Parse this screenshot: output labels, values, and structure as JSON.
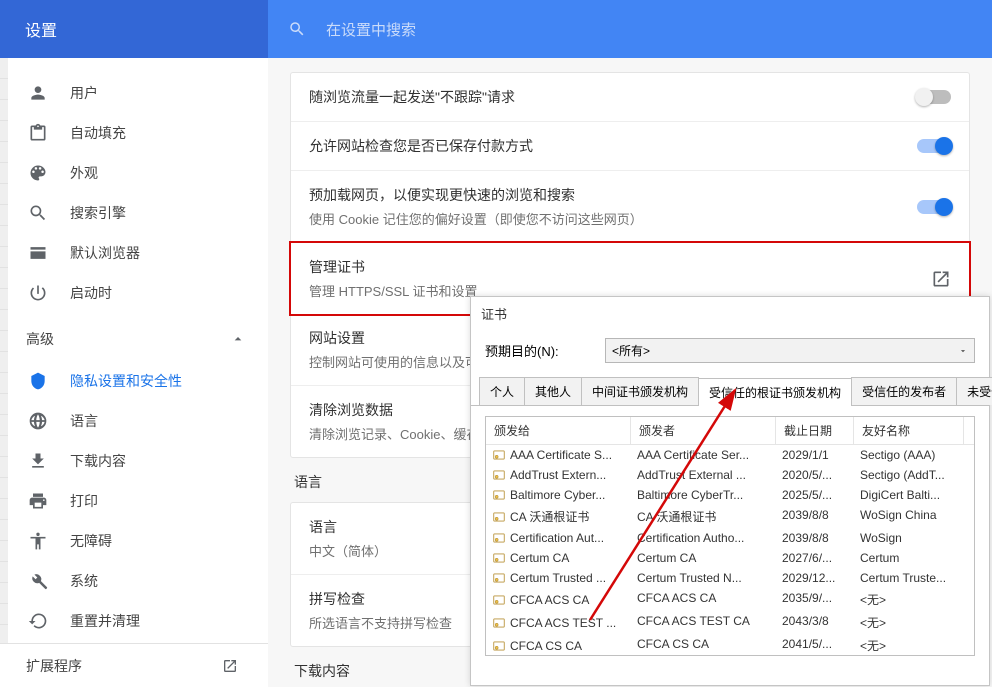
{
  "topbar": {
    "title": "设置",
    "search_placeholder": "在设置中搜索"
  },
  "sidebar": {
    "items": [
      {
        "label": "用户",
        "icon": "person"
      },
      {
        "label": "自动填充",
        "icon": "clipboard"
      },
      {
        "label": "外观",
        "icon": "palette"
      },
      {
        "label": "搜索引擎",
        "icon": "search"
      },
      {
        "label": "默认浏览器",
        "icon": "browser"
      },
      {
        "label": "启动时",
        "icon": "power"
      }
    ],
    "advanced_label": "高级",
    "advanced_items": [
      {
        "label": "隐私设置和安全性",
        "icon": "shield",
        "active": true
      },
      {
        "label": "语言",
        "icon": "globe"
      },
      {
        "label": "下载内容",
        "icon": "download"
      },
      {
        "label": "打印",
        "icon": "print"
      },
      {
        "label": "无障碍",
        "icon": "accessibility"
      },
      {
        "label": "系统",
        "icon": "wrench"
      },
      {
        "label": "重置并清理",
        "icon": "restore"
      }
    ],
    "footer_label": "扩展程序"
  },
  "settings_rows": [
    {
      "title": "随浏览流量一起发送\"不跟踪\"请求",
      "subtitle": "",
      "control": "toggle",
      "value": false
    },
    {
      "title": "允许网站检查您是否已保存付款方式",
      "subtitle": "",
      "control": "toggle",
      "value": true
    },
    {
      "title": "预加载网页，以便实现更快速的浏览和搜索",
      "subtitle": "使用 Cookie 记住您的偏好设置（即使您不访问这些网页）",
      "control": "toggle",
      "value": true
    },
    {
      "title": "管理证书",
      "subtitle": "管理 HTTPS/SSL 证书和设置",
      "control": "launch",
      "highlight": true
    },
    {
      "title": "网站设置",
      "subtitle": "控制网站可使用的信息以及可",
      "control": "none"
    },
    {
      "title": "清除浏览数据",
      "subtitle": "清除浏览记录、Cookie、缓存",
      "control": "none"
    }
  ],
  "lang_section": {
    "label": "语言",
    "rows": [
      {
        "title": "语言",
        "subtitle": "中文（简体）"
      },
      {
        "title": "拼写检查",
        "subtitle": "所选语言不支持拼写检查"
      }
    ]
  },
  "download_section_label": "下载内容",
  "cert_dialog": {
    "title": "证书",
    "purpose_label": "预期目的(N):",
    "purpose_value": "<所有>",
    "tabs": [
      "个人",
      "其他人",
      "中间证书颁发机构",
      "受信任的根证书颁发机构",
      "受信任的发布者",
      "未受信任的"
    ],
    "active_tab": 3,
    "columns": [
      "颁发给",
      "颁发者",
      "截止日期",
      "友好名称"
    ],
    "rows": [
      {
        "to": "AAA Certificate S...",
        "by": "AAA Certificate Ser...",
        "exp": "2029/1/1",
        "friendly": "Sectigo (AAA)"
      },
      {
        "to": "AddTrust Extern...",
        "by": "AddTrust External ...",
        "exp": "2020/5/...",
        "friendly": "Sectigo (AddT..."
      },
      {
        "to": "Baltimore Cyber...",
        "by": "Baltimore CyberTr...",
        "exp": "2025/5/...",
        "friendly": "DigiCert Balti..."
      },
      {
        "to": "CA 沃通根证书",
        "by": "CA 沃通根证书",
        "exp": "2039/8/8",
        "friendly": "WoSign China"
      },
      {
        "to": "Certification Aut...",
        "by": "Certification Autho...",
        "exp": "2039/8/8",
        "friendly": "WoSign"
      },
      {
        "to": "Certum CA",
        "by": "Certum CA",
        "exp": "2027/6/...",
        "friendly": "Certum"
      },
      {
        "to": "Certum Trusted ...",
        "by": "Certum Trusted N...",
        "exp": "2029/12...",
        "friendly": "Certum Truste..."
      },
      {
        "to": "CFCA ACS CA",
        "by": "CFCA ACS CA",
        "exp": "2035/9/...",
        "friendly": "<无>"
      },
      {
        "to": "CFCA ACS TEST ...",
        "by": "CFCA ACS TEST CA",
        "exp": "2043/3/8",
        "friendly": "<无>"
      },
      {
        "to": "CFCA CS CA",
        "by": "CFCA CS CA",
        "exp": "2041/5/...",
        "friendly": "<无>"
      }
    ]
  }
}
